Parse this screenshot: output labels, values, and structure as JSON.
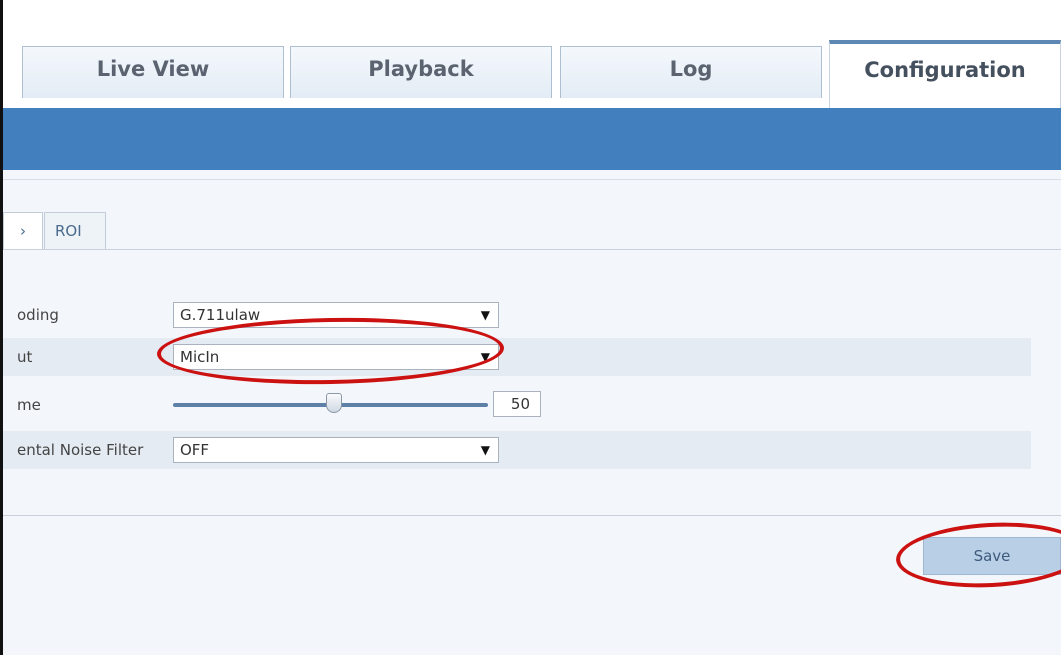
{
  "tabs": {
    "live_view": "Live View",
    "playback": "Playback",
    "log": "Log",
    "configuration": "Configuration"
  },
  "subtabs": {
    "audio_fragment": "›",
    "roi": "ROI"
  },
  "form": {
    "encoding": {
      "label": "oding",
      "value": "G.711ulaw"
    },
    "input": {
      "label": "ut",
      "value": "MicIn"
    },
    "volume": {
      "label": "me",
      "value": "50"
    },
    "noise_filter": {
      "label": "ental Noise Filter",
      "value": "OFF"
    }
  },
  "controls": {
    "dropdown_arrow": "▼",
    "volume_level_percent": 50
  },
  "save_button": "Save",
  "colors": {
    "header_bar": "#417fbe",
    "annotation": "#cc1111",
    "save_button_bg": "#b9cfe6"
  }
}
